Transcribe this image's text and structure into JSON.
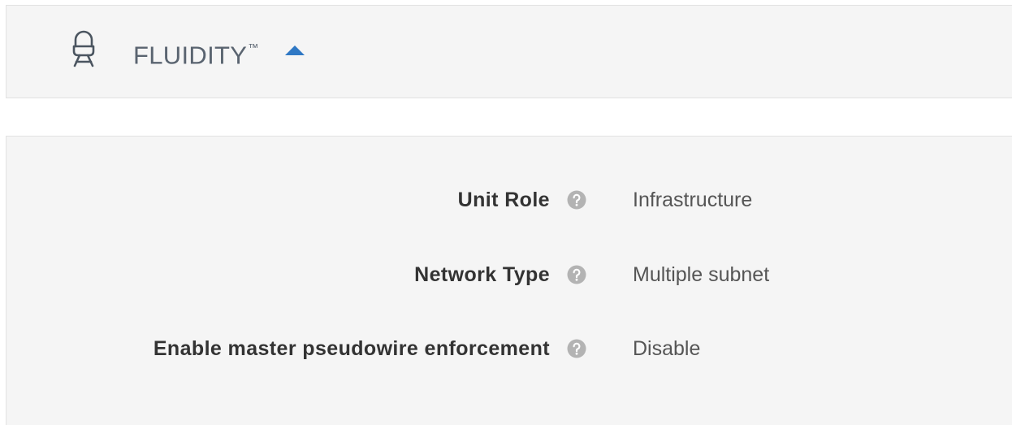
{
  "header": {
    "title": "FLUIDITY",
    "trademark": "™",
    "icon": "fluidity-train-icon",
    "toggle_icon": "caret-up-icon",
    "accent_color": "#2f78c4"
  },
  "settings": [
    {
      "label": "Unit Role",
      "value": "Infrastructure",
      "help_icon": "help-circle-icon"
    },
    {
      "label": "Network Type",
      "value": "Multiple subnet",
      "help_icon": "help-circle-icon"
    },
    {
      "label": "Enable master pseudowire enforcement",
      "value": "Disable",
      "help_icon": "help-circle-icon"
    }
  ],
  "colors": {
    "panel_background": "#f5f5f5",
    "label_text": "#333333",
    "value_text": "#555555",
    "help_icon": "#b3b3b3"
  }
}
